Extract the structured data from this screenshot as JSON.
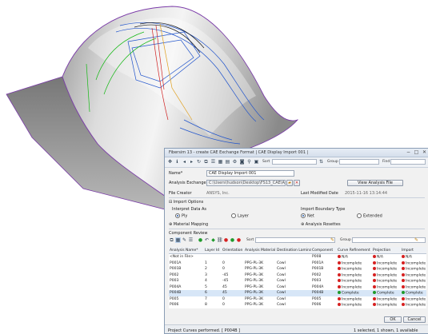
{
  "window": {
    "title": "Fibersim 13 - create CAE Exchange Format | CAE Display Import 001 |",
    "minimize": "−",
    "maximize": "□",
    "close": "✕"
  },
  "toolbar": {
    "sort_label": "Sort",
    "group_label": "Group",
    "find_label": "Find"
  },
  "form": {
    "name_label": "Name*",
    "name_value": "CAE Display Import 001",
    "exchange_file_label": "Analysis Exchange File",
    "exchange_file_value": "C:\\Users\\hudson\\Desktop\\FS13_CAE\\ACP\\vCSV",
    "view_button": "View Analysis File",
    "file_creator_label": "File Creator",
    "file_creator_value": "ANSYS, Inc.",
    "last_modified_label": "Last Modified Date",
    "last_modified_value": "2015-11-16 13:14:44"
  },
  "import_options": {
    "header": "Import Options",
    "interpret_label": "Interpret Data As",
    "ply_label": "Ply",
    "layer_label": "Layer",
    "boundary_label": "Import Boundary Type",
    "net_label": "Net",
    "extended_label": "Extended",
    "material_mapping": "Material Mapping",
    "analysis_rosettes": "Analysis Rosettes"
  },
  "component_review": {
    "header": "Component Review",
    "sort_label": "Sort",
    "group_label": "Group",
    "columns": [
      "Analysis Name*",
      "Layer Id",
      "Orientation",
      "Analysis Material",
      "Destination Laminate",
      "Component",
      "Curve Refinement",
      "Projection",
      "Import"
    ],
    "rows": [
      {
        "name": "<Not in File>",
        "layer": "",
        "orient": "",
        "material": "",
        "dest": "",
        "comp": "P008",
        "curve": "N/A",
        "curve_c": "na",
        "proj": "N/A",
        "proj_c": "na",
        "imp": "N/A",
        "imp_c": "na",
        "sel": false
      },
      {
        "name": "P001A",
        "layer": "1",
        "orient": "0",
        "material": "PPG-PL-3K",
        "dest": "Cowl",
        "comp": "P001A",
        "curve": "Incomplete",
        "curve_c": "red",
        "proj": "Incomplete",
        "proj_c": "red",
        "imp": "Incomplete",
        "imp_c": "red",
        "sel": false
      },
      {
        "name": "P001B",
        "layer": "2",
        "orient": "0",
        "material": "PPG-PL-3K",
        "dest": "Cowl",
        "comp": "P001B",
        "curve": "Incomplete",
        "curve_c": "red",
        "proj": "Incomplete",
        "proj_c": "red",
        "imp": "Incomplete",
        "imp_c": "red",
        "sel": false
      },
      {
        "name": "P002",
        "layer": "3",
        "orient": "-45",
        "material": "PPG-PL-3K",
        "dest": "Cowl",
        "comp": "P002",
        "curve": "Incomplete",
        "curve_c": "red",
        "proj": "Incomplete",
        "proj_c": "red",
        "imp": "Incomplete",
        "imp_c": "red",
        "sel": false
      },
      {
        "name": "P003",
        "layer": "4",
        "orient": "-45",
        "material": "PPG-PL-3K",
        "dest": "Cowl",
        "comp": "P003",
        "curve": "Incomplete",
        "curve_c": "red",
        "proj": "Incomplete",
        "proj_c": "red",
        "imp": "Incomplete",
        "imp_c": "red",
        "sel": false
      },
      {
        "name": "P004A",
        "layer": "5",
        "orient": "45",
        "material": "PPG-PL-3K",
        "dest": "Cowl",
        "comp": "P004A",
        "curve": "Incomplete",
        "curve_c": "red",
        "proj": "Incomplete",
        "proj_c": "red",
        "imp": "Incomplete",
        "imp_c": "red",
        "sel": false
      },
      {
        "name": "P004B",
        "layer": "6",
        "orient": "45",
        "material": "PPG-PL-3K",
        "dest": "Cowl",
        "comp": "P004B",
        "curve": "Complete",
        "curve_c": "green",
        "proj": "Complete",
        "proj_c": "green",
        "imp": "Complete",
        "imp_c": "green",
        "sel": true
      },
      {
        "name": "P005",
        "layer": "7",
        "orient": "0",
        "material": "PPG-PL-3K",
        "dest": "Cowl",
        "comp": "P005",
        "curve": "Incomplete",
        "curve_c": "red",
        "proj": "Incomplete",
        "proj_c": "red",
        "imp": "Incomplete",
        "imp_c": "red",
        "sel": false
      },
      {
        "name": "P006",
        "layer": "8",
        "orient": "0",
        "material": "PPG-PL-3K",
        "dest": "Cowl",
        "comp": "P006",
        "curve": "Incomplete",
        "curve_c": "red",
        "proj": "Incomplete",
        "proj_c": "red",
        "imp": "Incomplete",
        "imp_c": "red",
        "sel": false
      }
    ]
  },
  "footer": {
    "ok_button": "OK",
    "cancel_button": "Cancel",
    "status_left": "Project Curves performed. [ P004B ]",
    "status_right": "1 selected, 1 shown, 1 available"
  },
  "colors": {
    "complete": "#1f9a2b",
    "incomplete": "#d62020",
    "accent": "#2a5ea8"
  }
}
